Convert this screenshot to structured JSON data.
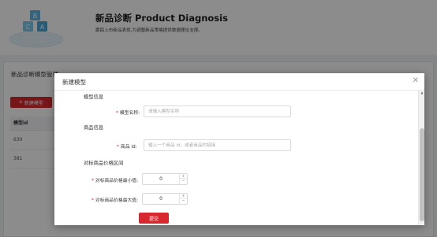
{
  "header": {
    "title": "新品诊断 Product Diagnosis",
    "description": "跟踪上市新品表现,为调整新品策略提供数据理论支撑。",
    "logo_letters": [
      "B",
      "C",
      "A"
    ]
  },
  "background": {
    "panel_title": "新品诊断模型管理",
    "new_button_label": "新建模型",
    "table": {
      "columns": [
        "模型id"
      ],
      "rows": [
        "630",
        "381"
      ]
    }
  },
  "modal": {
    "title": "新建模型",
    "close_icon": "close-icon",
    "sections": {
      "model_info": "模型信息",
      "product_info": "商品信息",
      "price_range": "对标商品价格区间"
    },
    "fields": {
      "model_name": {
        "label": "模型名称:",
        "placeholder": "请输入模型名称",
        "value": ""
      },
      "product_id": {
        "label": "商品 id:",
        "placeholder": "输入一个商品 id。或者商品的链接",
        "value": ""
      },
      "price_min": {
        "label": "对标商品价格最小值:",
        "value": "0"
      },
      "price_max": {
        "label": "对标商品价格最大值:",
        "value": "0"
      }
    },
    "submit_label": "提交"
  },
  "colors": {
    "accent": "#d8282f",
    "mask": "rgba(0,0,0,0.45)",
    "logo_blue": "#6cc3e8"
  }
}
